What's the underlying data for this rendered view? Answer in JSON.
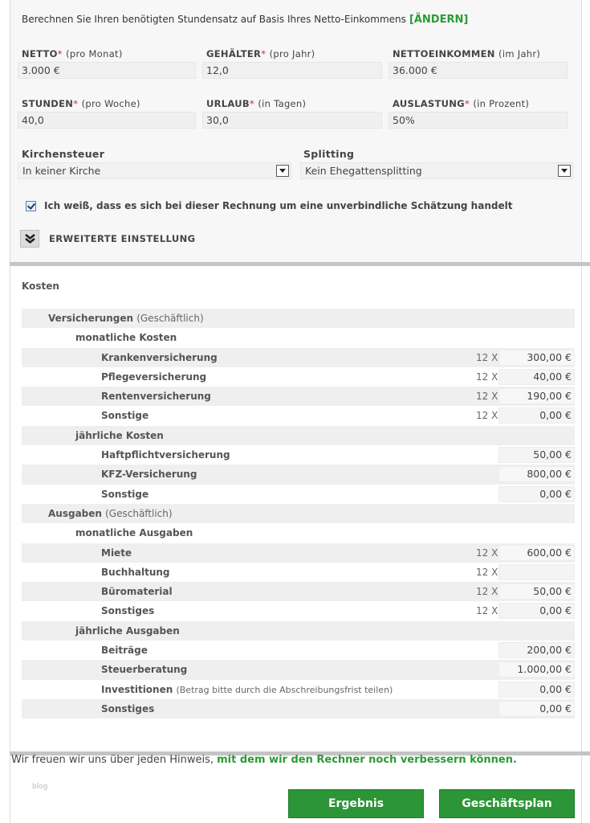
{
  "intro": {
    "text": "Berechnen Sie Ihren benötigten Stundensatz auf Basis Ihres Netto-Einkommens",
    "change_link": "[ÄNDERN]"
  },
  "fields": [
    {
      "label": "NETTO",
      "required": "*",
      "unit": "(pro Monat)",
      "value": "3.000 €"
    },
    {
      "label": "GEHÄLTER",
      "required": "*",
      "unit": "(pro Jahr)",
      "value": "12,0"
    },
    {
      "label": "NETTOEINKOMMEN",
      "required": "",
      "unit": "(im Jahr)",
      "value": "36.000 €"
    },
    {
      "label": "STUNDEN",
      "required": "*",
      "unit": "(pro Woche)",
      "value": "40,0"
    },
    {
      "label": "URLAUB",
      "required": "*",
      "unit": "(in Tagen)",
      "value": "30,0"
    },
    {
      "label": "AUSLASTUNG",
      "required": "*",
      "unit": "(in Prozent)",
      "value": "50%"
    }
  ],
  "selects": {
    "church": {
      "label": "Kirchensteuer",
      "value": "In keiner Kirche"
    },
    "splitting": {
      "label": "Splitting",
      "value": "Kein Ehegattensplitting"
    }
  },
  "disclaimer": {
    "label": "Ich weiß, dass es sich bei dieser Rechnung um eine unverbindliche Schätzung handelt",
    "checked": true
  },
  "advanced": {
    "label": "ERWEITERTE EINSTELLUNG",
    "icon": "double-chevron-down-icon"
  },
  "costs": {
    "title": "Kosten",
    "rows": [
      {
        "level": 1,
        "label": "Versicherungen",
        "note": "(Geschäftlich)",
        "mult": "",
        "value": null
      },
      {
        "level": 2,
        "label": "monatliche Kosten",
        "note": "",
        "mult": "",
        "value": null
      },
      {
        "level": 3,
        "label": "Krankenversicherung",
        "note": "",
        "mult": "12 X",
        "value": "300,00 €"
      },
      {
        "level": 3,
        "label": "Pflegeversicherung",
        "note": "",
        "mult": "12 X",
        "value": "40,00 €"
      },
      {
        "level": 3,
        "label": "Rentenversicherung",
        "note": "",
        "mult": "12 X",
        "value": "190,00 €"
      },
      {
        "level": 3,
        "label": "Sonstige",
        "note": "",
        "mult": "12 X",
        "value": "0,00 €"
      },
      {
        "level": 2,
        "label": "jährliche Kosten",
        "note": "",
        "mult": "",
        "value": null
      },
      {
        "level": 3,
        "label": "Haftpflichtversicherung",
        "note": "",
        "mult": "",
        "value": "50,00 €"
      },
      {
        "level": 3,
        "label": "KFZ-Versicherung",
        "note": "",
        "mult": "",
        "value": "800,00 €"
      },
      {
        "level": 3,
        "label": "Sonstige",
        "note": "",
        "mult": "",
        "value": "0,00 €"
      },
      {
        "level": 1,
        "label": "Ausgaben",
        "note": "(Geschäftlich)",
        "mult": "",
        "value": null
      },
      {
        "level": 2,
        "label": "monatliche Ausgaben",
        "note": "",
        "mult": "",
        "value": null
      },
      {
        "level": 3,
        "label": "Miete",
        "note": "",
        "mult": "12 X",
        "value": "600,00 €"
      },
      {
        "level": 3,
        "label": "Buchhaltung",
        "note": "",
        "mult": "12 X",
        "value": ""
      },
      {
        "level": 3,
        "label": "Büromaterial",
        "note": "",
        "mult": "12 X",
        "value": "50,00 €"
      },
      {
        "level": 3,
        "label": "Sonstiges",
        "note": "",
        "mult": "12 X",
        "value": "0,00 €"
      },
      {
        "level": 2,
        "label": "jährliche Ausgaben",
        "note": "",
        "mult": "",
        "value": null
      },
      {
        "level": 3,
        "label": "Beiträge",
        "note": "",
        "mult": "",
        "value": "200,00 €"
      },
      {
        "level": 3,
        "label": "Steuerberatung",
        "note": "",
        "mult": "",
        "value": "1.000,00 €"
      },
      {
        "level": 3,
        "label": "Investitionen",
        "note": "(Betrag bitte durch die Abschreibungsfrist teilen)",
        "mult": "",
        "value": "0,00 €"
      },
      {
        "level": 3,
        "label": "Sonstiges",
        "note": "",
        "mult": "",
        "value": "0,00 €"
      }
    ]
  },
  "footer": {
    "text": "Wir freuen wir uns über jeden Hinweis,",
    "link": "mit dem wir den Rechner noch verbessern können.",
    "watermark": "blog"
  },
  "buttons": {
    "result": "Ergebnis",
    "businessplan": "Geschäftsplan"
  },
  "colors": {
    "accent": "#2b9537",
    "required": "#dd2222"
  }
}
